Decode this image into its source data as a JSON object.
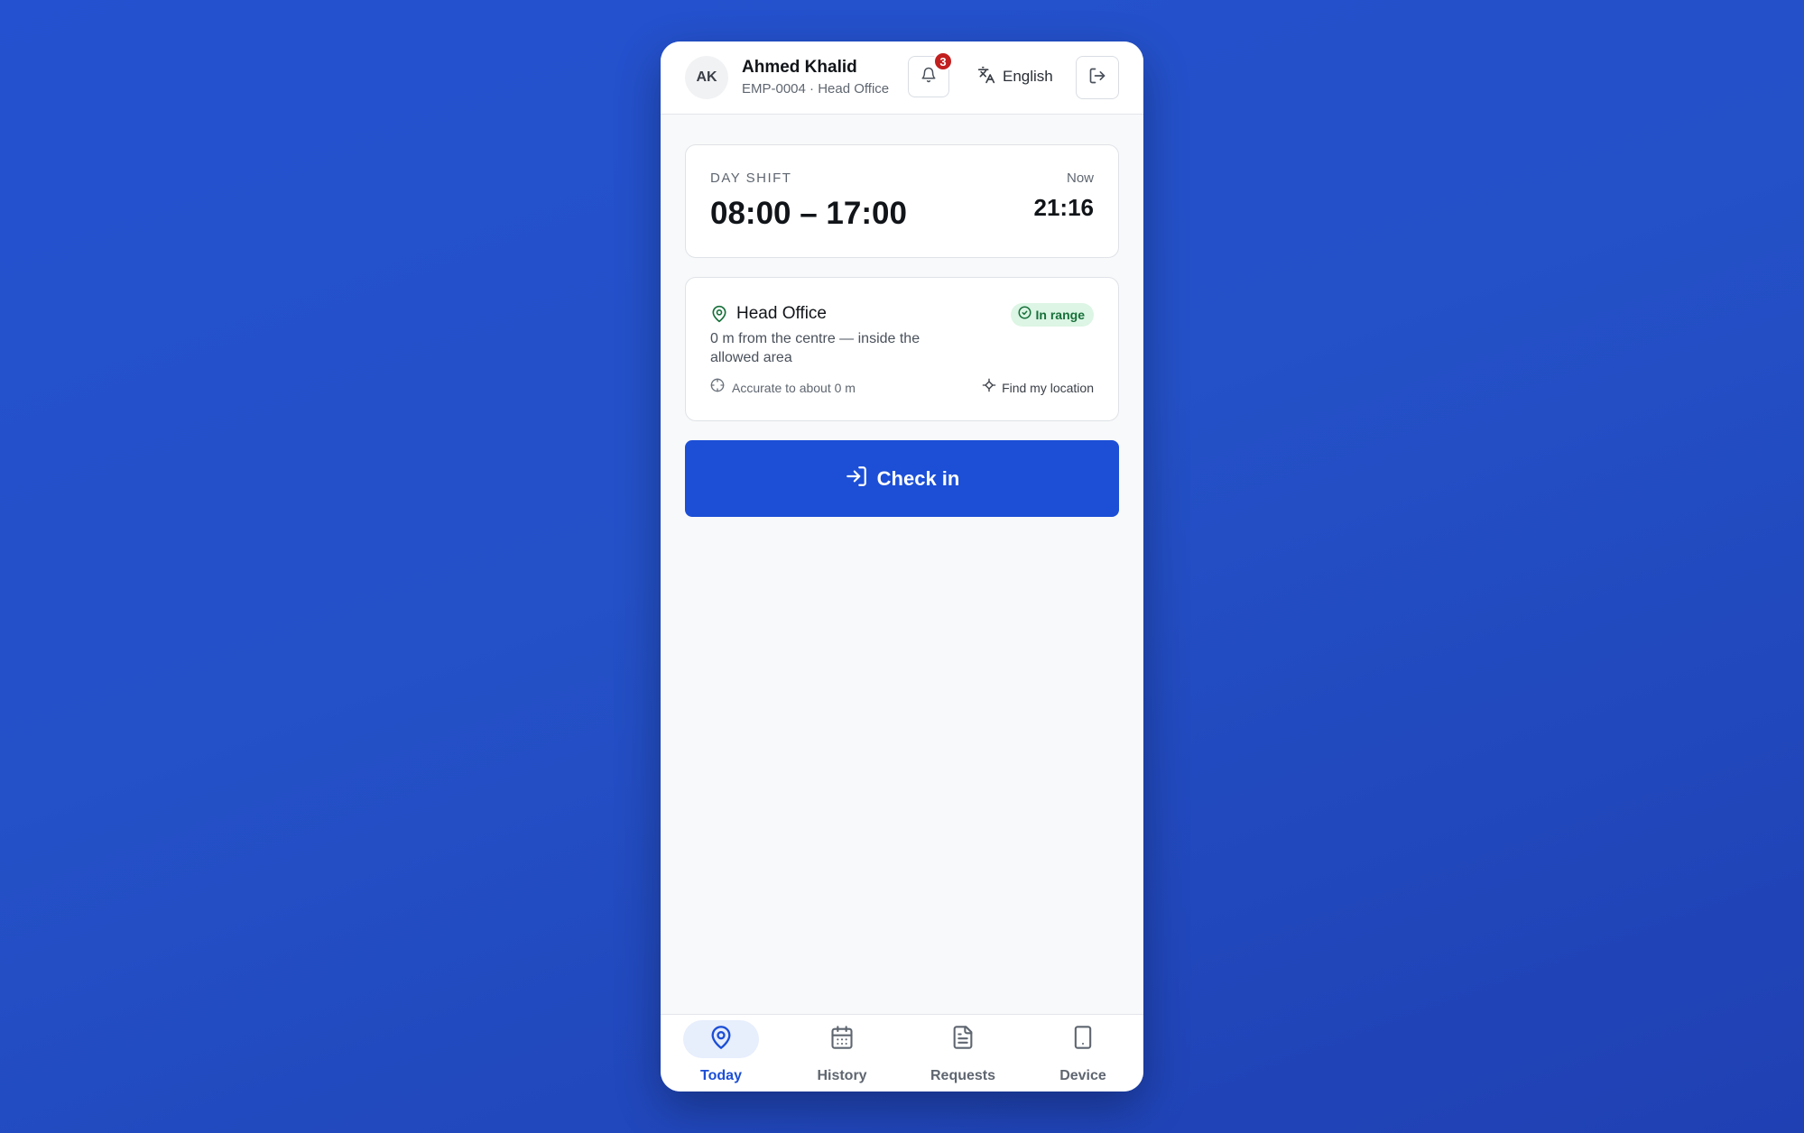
{
  "header": {
    "avatar_initials": "AK",
    "user_name": "Ahmed Khalid",
    "user_subtitle": "EMP-0004 · Head Office",
    "notification_count": "3",
    "language_label": "English"
  },
  "shift": {
    "label": "DAY SHIFT",
    "hours": "08:00 – 17:00",
    "now_label": "Now",
    "now_time": "21:16"
  },
  "location": {
    "name": "Head Office",
    "status_badge": "In range",
    "description": "0 m from the centre — inside the allowed area",
    "accuracy": "Accurate to about 0 m",
    "find_button": "Find my location"
  },
  "actions": {
    "check_in_label": "Check in"
  },
  "nav": {
    "items": [
      {
        "label": "Today",
        "icon": "location-pin-icon",
        "active": true
      },
      {
        "label": "History",
        "icon": "calendar-icon",
        "active": false
      },
      {
        "label": "Requests",
        "icon": "document-icon",
        "active": false
      },
      {
        "label": "Device",
        "icon": "phone-icon",
        "active": false
      }
    ]
  },
  "colors": {
    "background": "#2451cf",
    "primary": "#1c4fd6",
    "in_range_bg": "#dcf5e4",
    "in_range_text": "#17703a",
    "badge_red": "#c21f1f"
  }
}
